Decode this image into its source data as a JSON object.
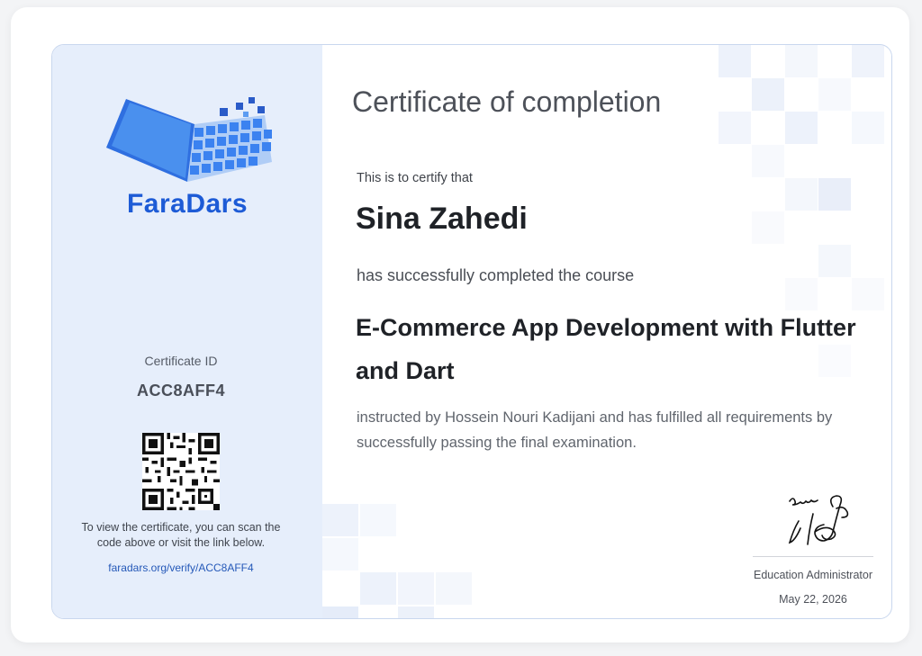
{
  "brand": {
    "name": "FaraDars",
    "logo_icon": "open-book-icon"
  },
  "certificate_id": {
    "label": "Certificate ID",
    "value": "ACC8AFF4"
  },
  "verify": {
    "instructions": "To view the certificate, you can scan the code above or visit the link below.",
    "link": "faradars.org/verify/ACC8AFF4"
  },
  "certificate": {
    "title": "Certificate of completion",
    "intro": "This is to certify that",
    "recipient": "Sina Zahedi",
    "completed_text": "has successfully completed the course",
    "course_name": "E-Commerce App Development with Flutter and Dart",
    "instructed_text": "instructed by Hossein Nouri Kadijani and has fulfilled all requirements by successfully passing the final examination."
  },
  "signature": {
    "role": "Education Administrator",
    "date": "May 22, 2026"
  },
  "colors": {
    "brand_blue": "#1d5bd6",
    "sidebar_bg": "#e6eefb",
    "border": "#c9d7ee"
  }
}
